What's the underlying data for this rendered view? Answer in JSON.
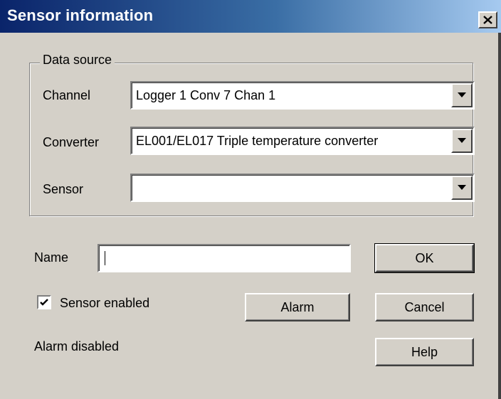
{
  "window": {
    "title": "Sensor information"
  },
  "data_source": {
    "legend": "Data source",
    "channel": {
      "label": "Channel",
      "value": "Logger 1 Conv 7 Chan 1"
    },
    "converter": {
      "label": "Converter",
      "value": "EL001/EL017 Triple temperature converter"
    },
    "sensor": {
      "label": "Sensor",
      "value": ""
    }
  },
  "name": {
    "label": "Name",
    "value": ""
  },
  "sensor_enabled": {
    "label": "Sensor enabled",
    "checked": true
  },
  "alarm_status": "Alarm disabled",
  "buttons": {
    "ok": "OK",
    "cancel": "Cancel",
    "help": "Help",
    "alarm": "Alarm"
  },
  "colors": {
    "titlebar_start": "#0a246a",
    "titlebar_end": "#a6caf0",
    "face": "#d4d0c8"
  }
}
